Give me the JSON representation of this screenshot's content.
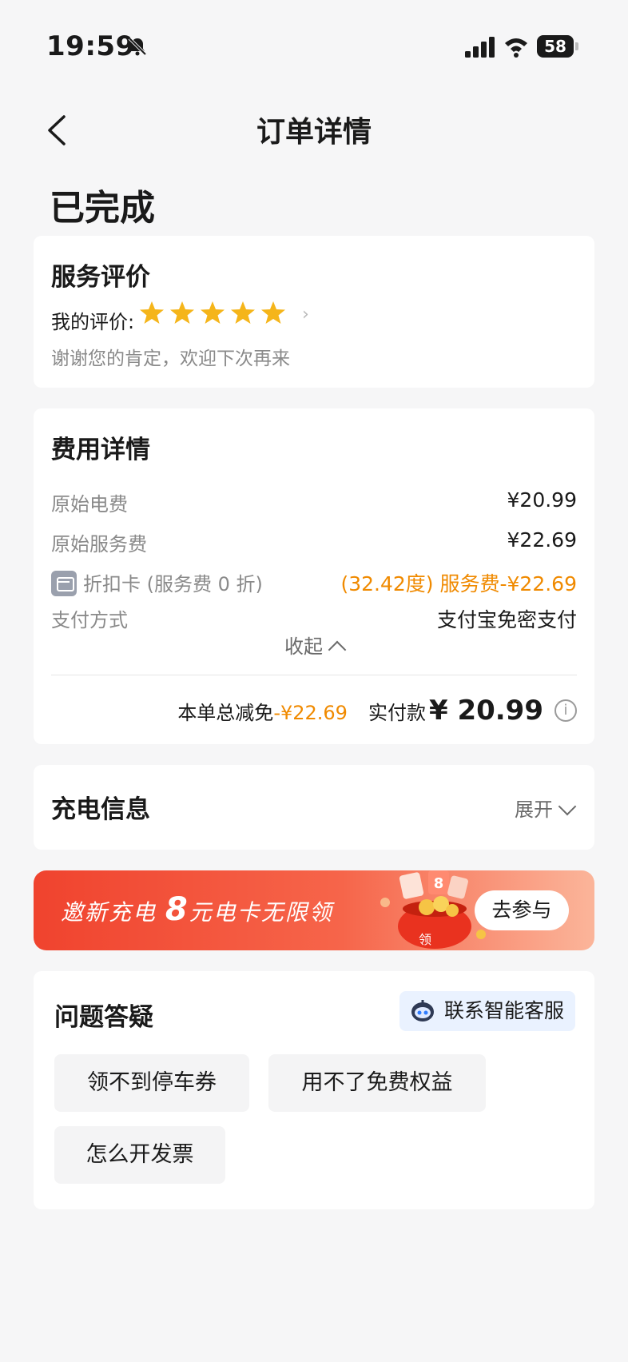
{
  "status_bar": {
    "time": "19:59",
    "battery": "58"
  },
  "nav": {
    "title": "订单详情"
  },
  "order": {
    "status": "已完成"
  },
  "rating": {
    "title": "服务评价",
    "label": "我的评价:",
    "stars": 5,
    "thanks": "谢谢您的肯定，欢迎下次再来"
  },
  "fees": {
    "title": "费用详情",
    "rows": [
      {
        "label": "原始电费",
        "value": "¥20.99"
      },
      {
        "label": "原始服务费",
        "value": "¥22.69"
      },
      {
        "label": "折扣卡 (服务费 0 折)",
        "value": "(32.42度) 服务费-¥22.69"
      },
      {
        "label": "支付方式",
        "value": "支付宝免密支付"
      }
    ],
    "collapse_label": "收起",
    "total_discount_label": "本单总减免",
    "total_discount_value": "-¥22.69",
    "paid_label": "实付款",
    "paid_value": "¥ 20.99",
    "info_glyph": "i"
  },
  "charging": {
    "title": "充电信息",
    "expand_label": "展开"
  },
  "banner": {
    "text_pre": "邀新充电",
    "text_big": "8",
    "text_post": "元电卡无限领",
    "gift_label": "领",
    "gift_number": "8",
    "button_label": "去参与"
  },
  "faq": {
    "title": "问题答疑",
    "support_label": "联系智能客服",
    "chips": [
      "领不到停车券",
      "用不了免费权益",
      "怎么开发票"
    ]
  },
  "colors": {
    "accent_orange": "#f08a00",
    "star": "#f5b51a",
    "banner_red": "#f0432e"
  }
}
